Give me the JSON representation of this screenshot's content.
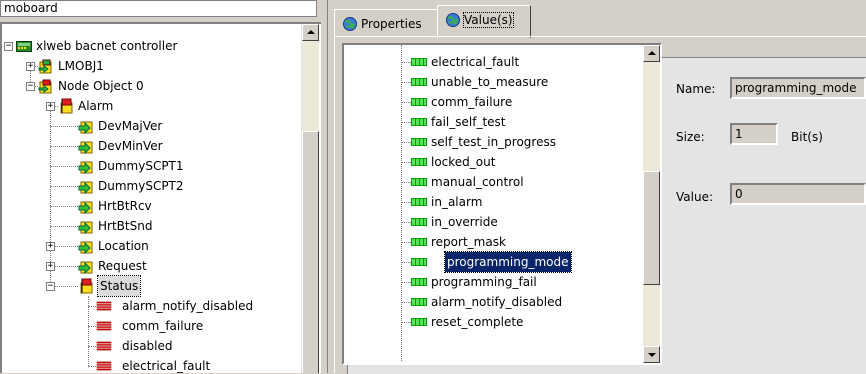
{
  "path_box": "moboard",
  "tree": {
    "items": [
      {
        "label": "xlweb bacnet controller",
        "icon": "controller-icon",
        "expander": "minus"
      },
      {
        "label": "LMOBJ1",
        "icon": "object-node-icon",
        "expander": "plus"
      },
      {
        "label": "Node Object 0",
        "icon": "node-object-icon",
        "expander": "minus"
      },
      {
        "label": "Alarm",
        "icon": "flag-red-icon",
        "expander": "plus"
      },
      {
        "label": "DevMajVer",
        "icon": "arrow-green-icon",
        "expander": ""
      },
      {
        "label": "DevMinVer",
        "icon": "arrow-green-icon",
        "expander": ""
      },
      {
        "label": "DummySCPT1",
        "icon": "arrow-green-icon",
        "expander": ""
      },
      {
        "label": "DummySCPT2",
        "icon": "arrow-green-icon",
        "expander": ""
      },
      {
        "label": "HrtBtRcv",
        "icon": "arrow-green-icon",
        "expander": ""
      },
      {
        "label": "HrtBtSnd",
        "icon": "arrow-green-icon",
        "expander": ""
      },
      {
        "label": "Location",
        "icon": "arrow-green-icon",
        "expander": "plus"
      },
      {
        "label": "Request",
        "icon": "arrow-green-icon",
        "expander": "plus"
      },
      {
        "label": "Status",
        "icon": "flag-red-icon",
        "expander": "minus",
        "selected": true
      },
      {
        "label": "alarm_notify_disabled",
        "icon": "bit-red-icon",
        "expander": ""
      },
      {
        "label": "comm_failure",
        "icon": "bit-red-icon",
        "expander": ""
      },
      {
        "label": "disabled",
        "icon": "bit-red-icon",
        "expander": ""
      },
      {
        "label": "electrical_fault",
        "icon": "bit-red-icon",
        "expander": ""
      }
    ]
  },
  "tabs": [
    {
      "label": "Properties",
      "icon": "globe-icon",
      "active": false
    },
    {
      "label": "Value(s)",
      "icon": "globe-icon",
      "active": true
    }
  ],
  "values_list": {
    "items": [
      {
        "label": "electrical_fault"
      },
      {
        "label": "unable_to_measure"
      },
      {
        "label": "comm_failure"
      },
      {
        "label": "fail_self_test"
      },
      {
        "label": "self_test_in_progress"
      },
      {
        "label": "locked_out"
      },
      {
        "label": "manual_control"
      },
      {
        "label": "in_alarm"
      },
      {
        "label": "in_override"
      },
      {
        "label": "report_mask"
      },
      {
        "label": "programming_mode",
        "selected": true
      },
      {
        "label": "programming_fail"
      },
      {
        "label": "alarm_notify_disabled"
      },
      {
        "label": "reset_complete"
      }
    ]
  },
  "details": {
    "name_label": "Name:",
    "name_value": "programming_mode",
    "size_label": "Size:",
    "size_value": "1",
    "size_unit": "Bit(s)",
    "value_label": "Value:",
    "value_value": "0"
  },
  "colors": {
    "selection": "#0a246a",
    "bit_icon_green": "#00c000",
    "bit_icon_red": "#c00000"
  }
}
